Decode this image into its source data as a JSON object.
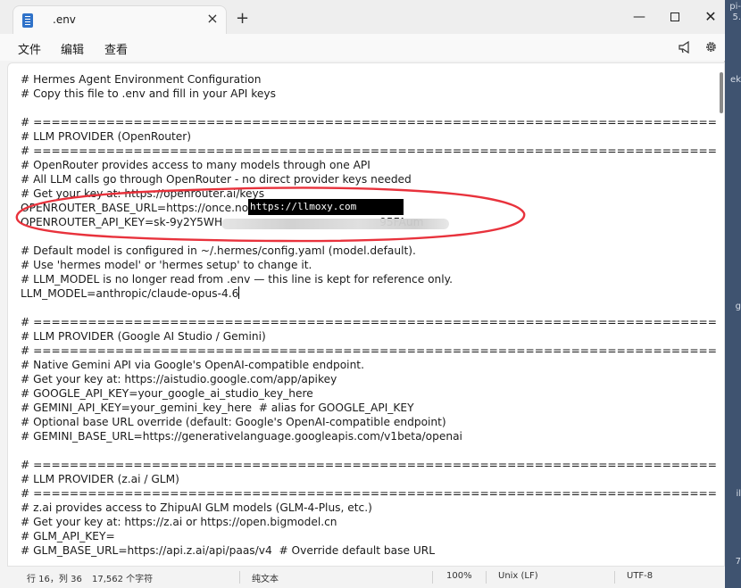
{
  "desktop": {
    "snippet_1": "pi-",
    "snippet_2": "ek",
    "snippet_3": "g",
    "snippet_4": "il",
    "snippet_5": "7",
    "snippet_6": "5."
  },
  "tab": {
    "title": ".env",
    "close": "×",
    "new": "+"
  },
  "window_controls": {
    "minimize": "—",
    "close": "✕"
  },
  "menu": {
    "file": "文件",
    "edit": "编辑",
    "view": "查看"
  },
  "editor": {
    "lines": [
      "# Hermes Agent Environment Configuration",
      "# Copy this file to .env and fill in your API keys",
      "",
      "# =============================================================================",
      "# LLM PROVIDER (OpenRouter)",
      "# =============================================================================",
      "# OpenRouter provides access to many models through one API",
      "# All LLM calls go through OpenRouter - no direct provider keys needed",
      "# Get your key at: https://openrouter.ai/keys",
      "OPENROUTER_BASE_URL=https://once.no",
      "OPENROUTER_API_KEY=sk-9y2Y5WH",
      "",
      "# Default model is configured in ~/.hermes/config.yaml (model.default).",
      "# Use 'hermes model' or 'hermes setup' to change it.",
      "# LLM_MODEL is no longer read from .env — this line is kept for reference only.",
      "LLM_MODEL=anthropic/claude-opus-4.6",
      "",
      "# =============================================================================",
      "# LLM PROVIDER (Google AI Studio / Gemini)",
      "# =============================================================================",
      "# Native Gemini API via Google's OpenAI-compatible endpoint.",
      "# Get your key at: https://aistudio.google.com/app/apikey",
      "# GOOGLE_API_KEY=your_google_ai_studio_key_here",
      "# GEMINI_API_KEY=your_gemini_key_here  # alias for GOOGLE_API_KEY",
      "# Optional base URL override (default: Google's OpenAI-compatible endpoint)",
      "# GEMINI_BASE_URL=https://generativelanguage.googleapis.com/v1beta/openai",
      "",
      "# =============================================================================",
      "# LLM PROVIDER (z.ai / GLM)",
      "# =============================================================================",
      "# z.ai provides access to ZhipuAI GLM models (GLM-4-Plus, etc.)",
      "# Get your key at: https://z.ai or https://open.bigmodel.cn",
      "# GLM_API_KEY=",
      "# GLM_BASE_URL=https://api.z.ai/api/paas/v4  # Override default base URL"
    ],
    "key_suffix": "95FAum",
    "overlay_url": "https://llmoxy.com"
  },
  "status": {
    "position": "行 16，列 36",
    "char_count": "17,562 个字符",
    "file_type": "纯文本",
    "zoom": "100%",
    "line_ending": "Unix (LF)",
    "encoding": "UTF-8"
  },
  "colors": {
    "annotation": "#e8323c",
    "accent": "#2f72c9"
  }
}
